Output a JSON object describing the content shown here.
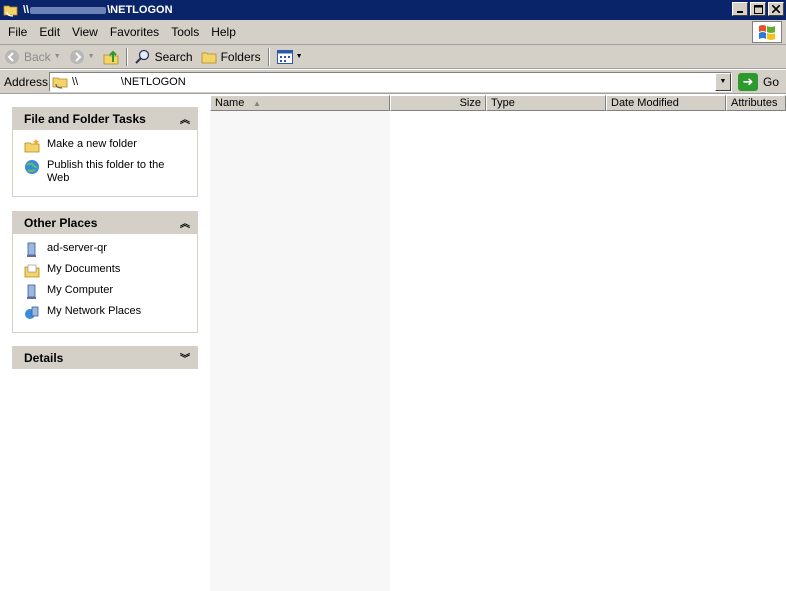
{
  "window": {
    "title_prefix": "\\\\",
    "title_suffix": "\\NETLOGON"
  },
  "menu": {
    "items": [
      "File",
      "Edit",
      "View",
      "Favorites",
      "Tools",
      "Help"
    ]
  },
  "toolbar": {
    "back_label": "Back",
    "search_label": "Search",
    "folders_label": "Folders"
  },
  "address": {
    "label": "Address",
    "value": "\\\\              \\NETLOGON",
    "go_label": "Go"
  },
  "tasks_panel": {
    "title": "File and Folder Tasks",
    "items": [
      "Make a new folder",
      "Publish this folder to the Web"
    ]
  },
  "places_panel": {
    "title": "Other Places",
    "items": [
      "ad-server-qr",
      "My Documents",
      "My Computer",
      "My Network Places"
    ]
  },
  "details_panel": {
    "title": "Details"
  },
  "columns": [
    "Name",
    "Size",
    "Type",
    "Date Modified",
    "Attributes"
  ],
  "colors": {
    "titlebar": "#0a246a",
    "chrome": "#d4d0c8",
    "sorted_column_bg": "#f7f7f7"
  }
}
